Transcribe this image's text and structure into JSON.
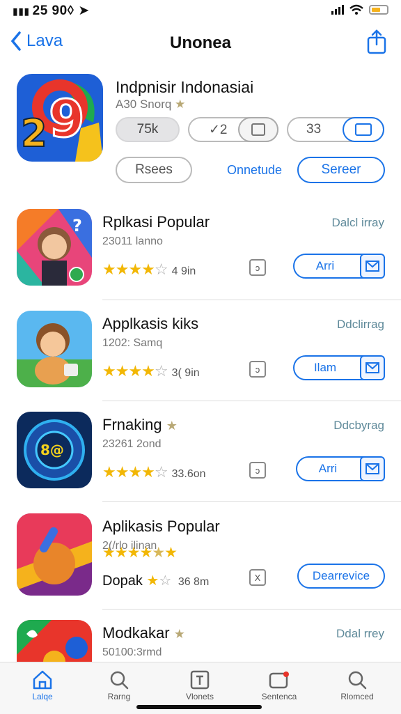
{
  "status": {
    "time": "25 90◊"
  },
  "nav": {
    "back_label": "Lava",
    "title": "Unonea"
  },
  "hero": {
    "name": "Indpnisir Indonasiai",
    "sub": "A30 Snorq",
    "pill_count": "75k",
    "pill_a": "✓2",
    "pill_b": "33",
    "btn_left": "Rsees",
    "btn_link": "Onnetude",
    "btn_right": "Sereer"
  },
  "apps": [
    {
      "name": "Rplkasi Popular",
      "meta": "23011 lanno",
      "rating_text": "4 9in",
      "tag": "Dalcl irray",
      "action": "Arri",
      "box": "ↄ"
    },
    {
      "name": "Applkasis kiks",
      "meta": "1202: Samq",
      "rating_text": "3( 9in",
      "tag": "Ddclirrag",
      "action": "Ilam",
      "box": "ↄ"
    },
    {
      "name": "Frnaking",
      "meta": "23261 2ond",
      "rating_text": "33.6on",
      "tag": "Ddcbyrag",
      "action": "Arri",
      "box": "ↄ"
    },
    {
      "name": "Aplikasis Popular",
      "meta": "2(/rlo ilinan",
      "rating_text": "36 8m",
      "prefix": "Dopak",
      "tag": "",
      "action": "Dearrevice",
      "box": "X"
    },
    {
      "name": "Modkakar",
      "meta": "50100:3rmd",
      "tag": "Ddal rrey"
    }
  ],
  "tabs": [
    {
      "label": "Lalqe",
      "icon": "home-icon"
    },
    {
      "label": "Rarng",
      "icon": "search-icon"
    },
    {
      "label": "Vlonets",
      "icon": "text-box-icon"
    },
    {
      "label": "Sentenca",
      "icon": "inbox-icon"
    },
    {
      "label": "Rlomced",
      "icon": "search-alt-icon"
    }
  ],
  "colors": {
    "accent": "#1a73e8",
    "star": "#f2b705"
  }
}
